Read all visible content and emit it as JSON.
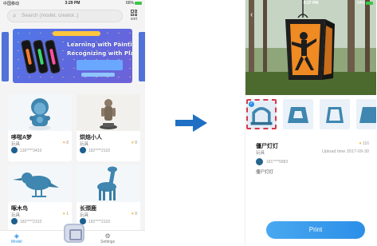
{
  "list_screen": {
    "status_bar": {
      "carrier": "中国移动",
      "time": "3:29 PM",
      "right": "66%"
    },
    "search": {
      "placeholder": "Search (model, creator..)"
    },
    "sort_label": "sort",
    "banner": {
      "title_line1": "Learning with Painting",
      "title_line2": "Recognizing with Playing"
    },
    "models": [
      {
        "name": "哆啦A梦",
        "category": "玩具",
        "user": "136****3433",
        "likes": "8"
      },
      {
        "name": "烘焙小人",
        "category": "玩具",
        "user": "182****2102",
        "likes": "8"
      },
      {
        "name": "啄木鸟",
        "category": "玩具",
        "user": "182****2102",
        "likes": "1"
      },
      {
        "name": "长颈鹿",
        "category": "玩具",
        "user": "182****2102",
        "likes": "8"
      }
    ],
    "tabs": {
      "model": "Model",
      "settings": "Settings"
    }
  },
  "detail_screen": {
    "status_bar": {
      "carrier": "",
      "time": "4:37 PM",
      "right": "64%"
    },
    "name": "僵尸灯灯",
    "category": "玩具",
    "likes": "116",
    "upload": "Upload time 2017-09-30",
    "user": "181****5883",
    "description": "僵尸灯灯",
    "print_label": "Print"
  },
  "colors": {
    "accent": "#2b8fe8",
    "model_color": "#3f86b0",
    "selection_border": "#d43a4a"
  },
  "icons": [
    "search-icon",
    "sort-grid-icon",
    "heart-icon",
    "model-tab-icon",
    "settings-gear-icon",
    "back-chevron-icon",
    "arrow-right-icon",
    "check-icon"
  ]
}
